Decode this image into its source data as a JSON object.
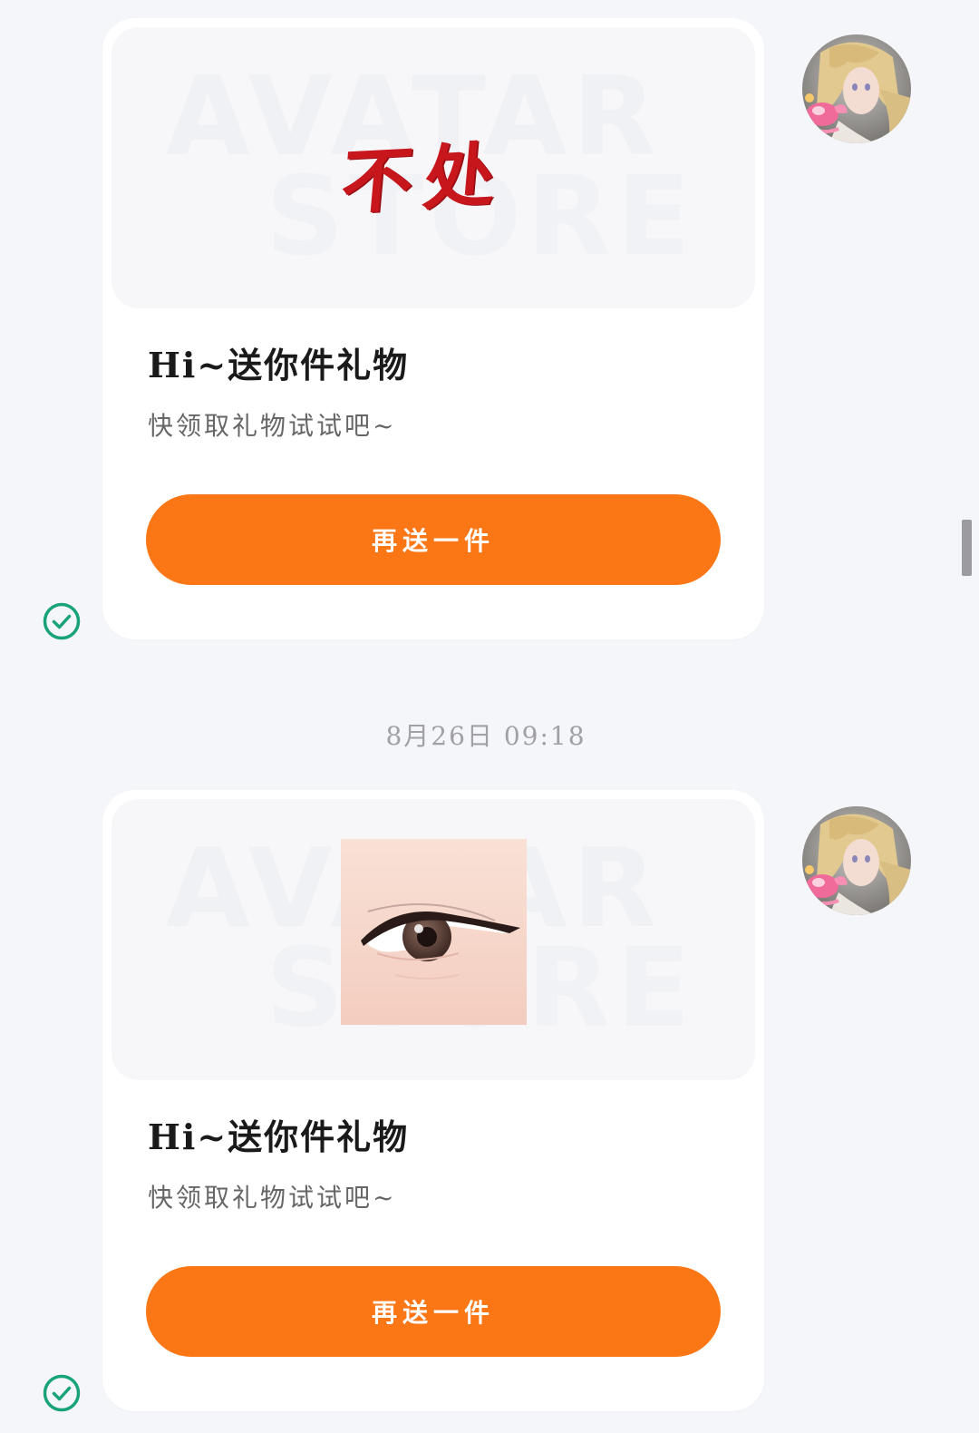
{
  "messages": [
    {
      "gift_art_text": "不处",
      "watermark_line1": "AVATAR",
      "watermark_line2": "STORE",
      "title": "Hi~送你件礼物",
      "subtitle": "快领取礼物试试吧~",
      "button_label": "再送一件",
      "status": "read",
      "preview_icon": "text-art-item"
    },
    {
      "watermark_line1": "AVATAR",
      "watermark_line2": "STORE",
      "title": "Hi~送你件礼物",
      "subtitle": "快领取礼物试试吧~",
      "button_label": "再送一件",
      "status": "read",
      "preview_icon": "eye-item"
    }
  ],
  "timestamp": "8月26日 09:18",
  "colors": {
    "background": "#f5f6f9",
    "card": "#ffffff",
    "button": "#fb7615",
    "check": "#1aa37a"
  }
}
